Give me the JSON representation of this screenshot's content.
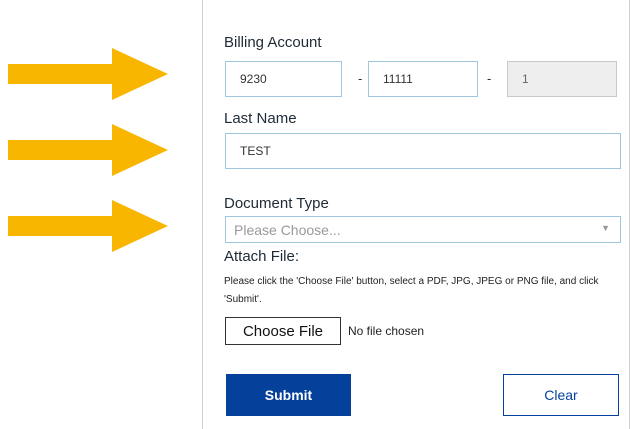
{
  "form": {
    "billing_account": {
      "label": "Billing Account",
      "part1": "9230",
      "separator1": "-",
      "part2": "11111",
      "separator2": "-",
      "part3": "1"
    },
    "last_name": {
      "label": "Last Name",
      "value": "TEST"
    },
    "document_type": {
      "label": "Document Type",
      "selected": "Please Choose..."
    },
    "attach_file": {
      "label": "Attach File:",
      "help_text": "Please click the 'Choose File' button, select a PDF, JPG, JPEG or PNG file, and click 'Submit'.",
      "choose_button": "Choose File",
      "status": "No file chosen"
    },
    "actions": {
      "submit": "Submit",
      "clear": "Clear"
    }
  },
  "annotations": {
    "arrow_color": "#f9b600",
    "arrow_count": 3
  }
}
